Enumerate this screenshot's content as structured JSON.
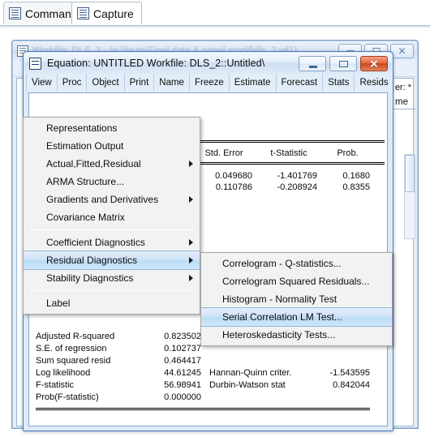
{
  "tabs": [
    {
      "label": "Command",
      "icon": "document-icon",
      "active": false
    },
    {
      "label": "Capture",
      "icon": "document-icon",
      "active": true
    }
  ],
  "background_window": {
    "title": "Workfile: DLS_2 - (p:\\ihsan\\Final data & panel modif\\dls_2.wf1)",
    "filter_label": "er: *",
    "name_label": "me",
    "buttons": {
      "minimize": "–",
      "maximize": "□",
      "close": "✕"
    }
  },
  "equation_window": {
    "icon": "equation-window-icon",
    "title": "Equation: UNTITLED   Workfile: DLS_2::Untitled\\",
    "buttons": {
      "minimize_name": "minimize-button",
      "maximize_name": "maximize-button",
      "close_name": "close-button",
      "close_glyph": "✕"
    },
    "toolbar": [
      {
        "label": "View"
      },
      {
        "label": "Proc"
      },
      {
        "label": "Object"
      },
      {
        "label": "Print"
      },
      {
        "label": "Name"
      },
      {
        "label": "Freeze"
      },
      {
        "label": "Estimate"
      },
      {
        "label": "Forecast"
      },
      {
        "label": "Stats"
      },
      {
        "label": "Resids"
      }
    ]
  },
  "results": {
    "column_headers": [
      "Std. Error",
      "t-Statistic",
      "Prob."
    ],
    "coef_rows": [
      {
        "std_error": "0.049680",
        "t_statistic": "-1.401769",
        "prob": "0.1680"
      },
      {
        "std_error": "0.110786",
        "t_statistic": "-0.208924",
        "prob": "0.8355"
      }
    ],
    "summary_left": [
      {
        "label": "Adjusted R-squared",
        "value": "0.823502"
      },
      {
        "label": "S.E. of regression",
        "value": "0.102737"
      },
      {
        "label": "Sum squared resid",
        "value": "0.464417"
      },
      {
        "label": "Log likelihood",
        "value": "44.61245"
      },
      {
        "label": "F-statistic",
        "value": "56.98941"
      },
      {
        "label": "Prob(F-statistic)",
        "value": "0.000000"
      }
    ],
    "summary_right": [
      {
        "label": "Hannan-Quinn criter.",
        "value": "-1.543595"
      },
      {
        "label": "Durbin-Watson stat",
        "value": "0.842044"
      }
    ]
  },
  "view_menu": {
    "items": [
      {
        "label": "Representations",
        "submenu": false,
        "selected": false
      },
      {
        "label": "Estimation Output",
        "submenu": false,
        "selected": false
      },
      {
        "label": "Actual,Fitted,Residual",
        "submenu": true,
        "selected": false
      },
      {
        "label": "ARMA Structure...",
        "submenu": false,
        "selected": false
      },
      {
        "label": "Gradients and Derivatives",
        "submenu": true,
        "selected": false
      },
      {
        "label": "Covariance Matrix",
        "submenu": false,
        "selected": false
      },
      {
        "separator": true
      },
      {
        "label": "Coefficient Diagnostics",
        "submenu": true,
        "selected": false
      },
      {
        "label": "Residual Diagnostics",
        "submenu": true,
        "selected": true
      },
      {
        "label": "Stability Diagnostics",
        "submenu": true,
        "selected": false
      },
      {
        "separator": true
      },
      {
        "label": "Label",
        "submenu": false,
        "selected": false
      }
    ]
  },
  "residual_submenu": {
    "items": [
      {
        "label": "Correlogram - Q-statistics...",
        "selected": false
      },
      {
        "label": "Correlogram Squared Residuals...",
        "selected": false
      },
      {
        "label": "Histogram - Normality Test",
        "selected": false
      },
      {
        "label": "Serial Correlation LM Test...",
        "selected": true
      },
      {
        "label": "Heteroskedasticity Tests...",
        "selected": false
      }
    ]
  },
  "colors": {
    "menu_highlight": "#badcf5",
    "menu_highlight_border": "#8fb8dd",
    "close_button_red": "#c8471c",
    "window_border_blue": "#4a7ab5",
    "titlebar_blue": "#dbe7f5"
  }
}
